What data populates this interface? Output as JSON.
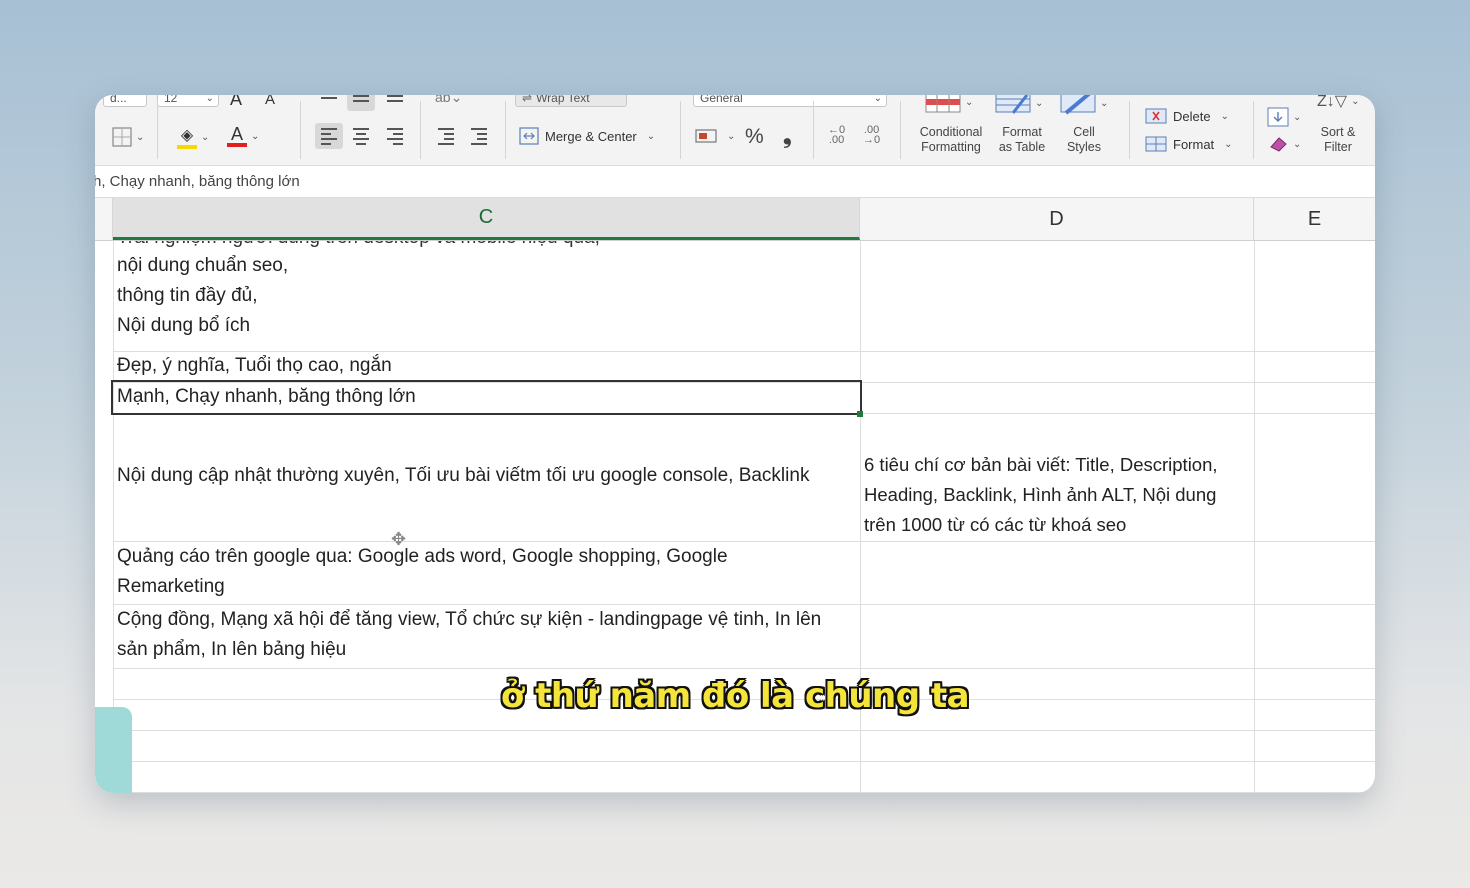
{
  "ribbon": {
    "font_name_cut": "d...",
    "font_size": "12",
    "font_grow": "A",
    "font_shrink": "A",
    "wrap_text": "Wrap Text",
    "merge_center": "Merge & Center",
    "number_format": "General",
    "percent": "%",
    "comma": "❟",
    "decimal_increase": ".00",
    "decimal_decrease": ".00",
    "conditional_formatting": [
      "Conditional",
      "Formatting"
    ],
    "format_as_table": [
      "Format",
      "as Table"
    ],
    "cell_styles": [
      "Cell",
      "Styles"
    ],
    "delete": "Delete",
    "format": "Format",
    "sort_filter": [
      "Sort &",
      "Filter"
    ],
    "font_color_accent": "#e02020",
    "fill_color_accent": "#f5d800"
  },
  "formula_bar": {
    "content": "h, Chạy nhanh, băng thông lớn"
  },
  "columns": [
    "C",
    "D",
    "E"
  ],
  "cells": {
    "c_row1_partial": "Trải nghiệm người dùng trên desktop và mobile hiệu quả,",
    "c_row1_lines": [
      "nội dung chuẩn seo,",
      "thông tin đầy đủ,",
      "Nội dung bổ ích"
    ],
    "c_row2": "Đẹp, ý nghĩa, Tuổi thọ cao, ngắn",
    "c_row3": "Mạnh, Chạy nhanh, băng thông lớn",
    "c_row4": "Nội dung cập nhật thường xuyên, Tối ưu bài viếtm tối ưu google console, Backlink",
    "d_row4_lines": [
      "6 tiêu chí cơ bản bài viết: Title, Description,",
      "Heading, Backlink, Hình ảnh ALT, Nội dung",
      "trên 1000 từ có các từ khoá seo"
    ],
    "c_row5_lines": [
      "Quảng cáo trên google qua: Google ads word, Google shopping, Google",
      "Remarketing"
    ],
    "c_row6_lines": [
      "Cộng đồng, Mạng xã hội để tăng view, Tổ chức sự kiện - landingpage vệ tinh, In lên",
      "sản phẩm, In lên bảng hiệu"
    ]
  },
  "subtitle": "ở thứ năm đó là chúng ta",
  "accent_green": "#1f7a3f"
}
